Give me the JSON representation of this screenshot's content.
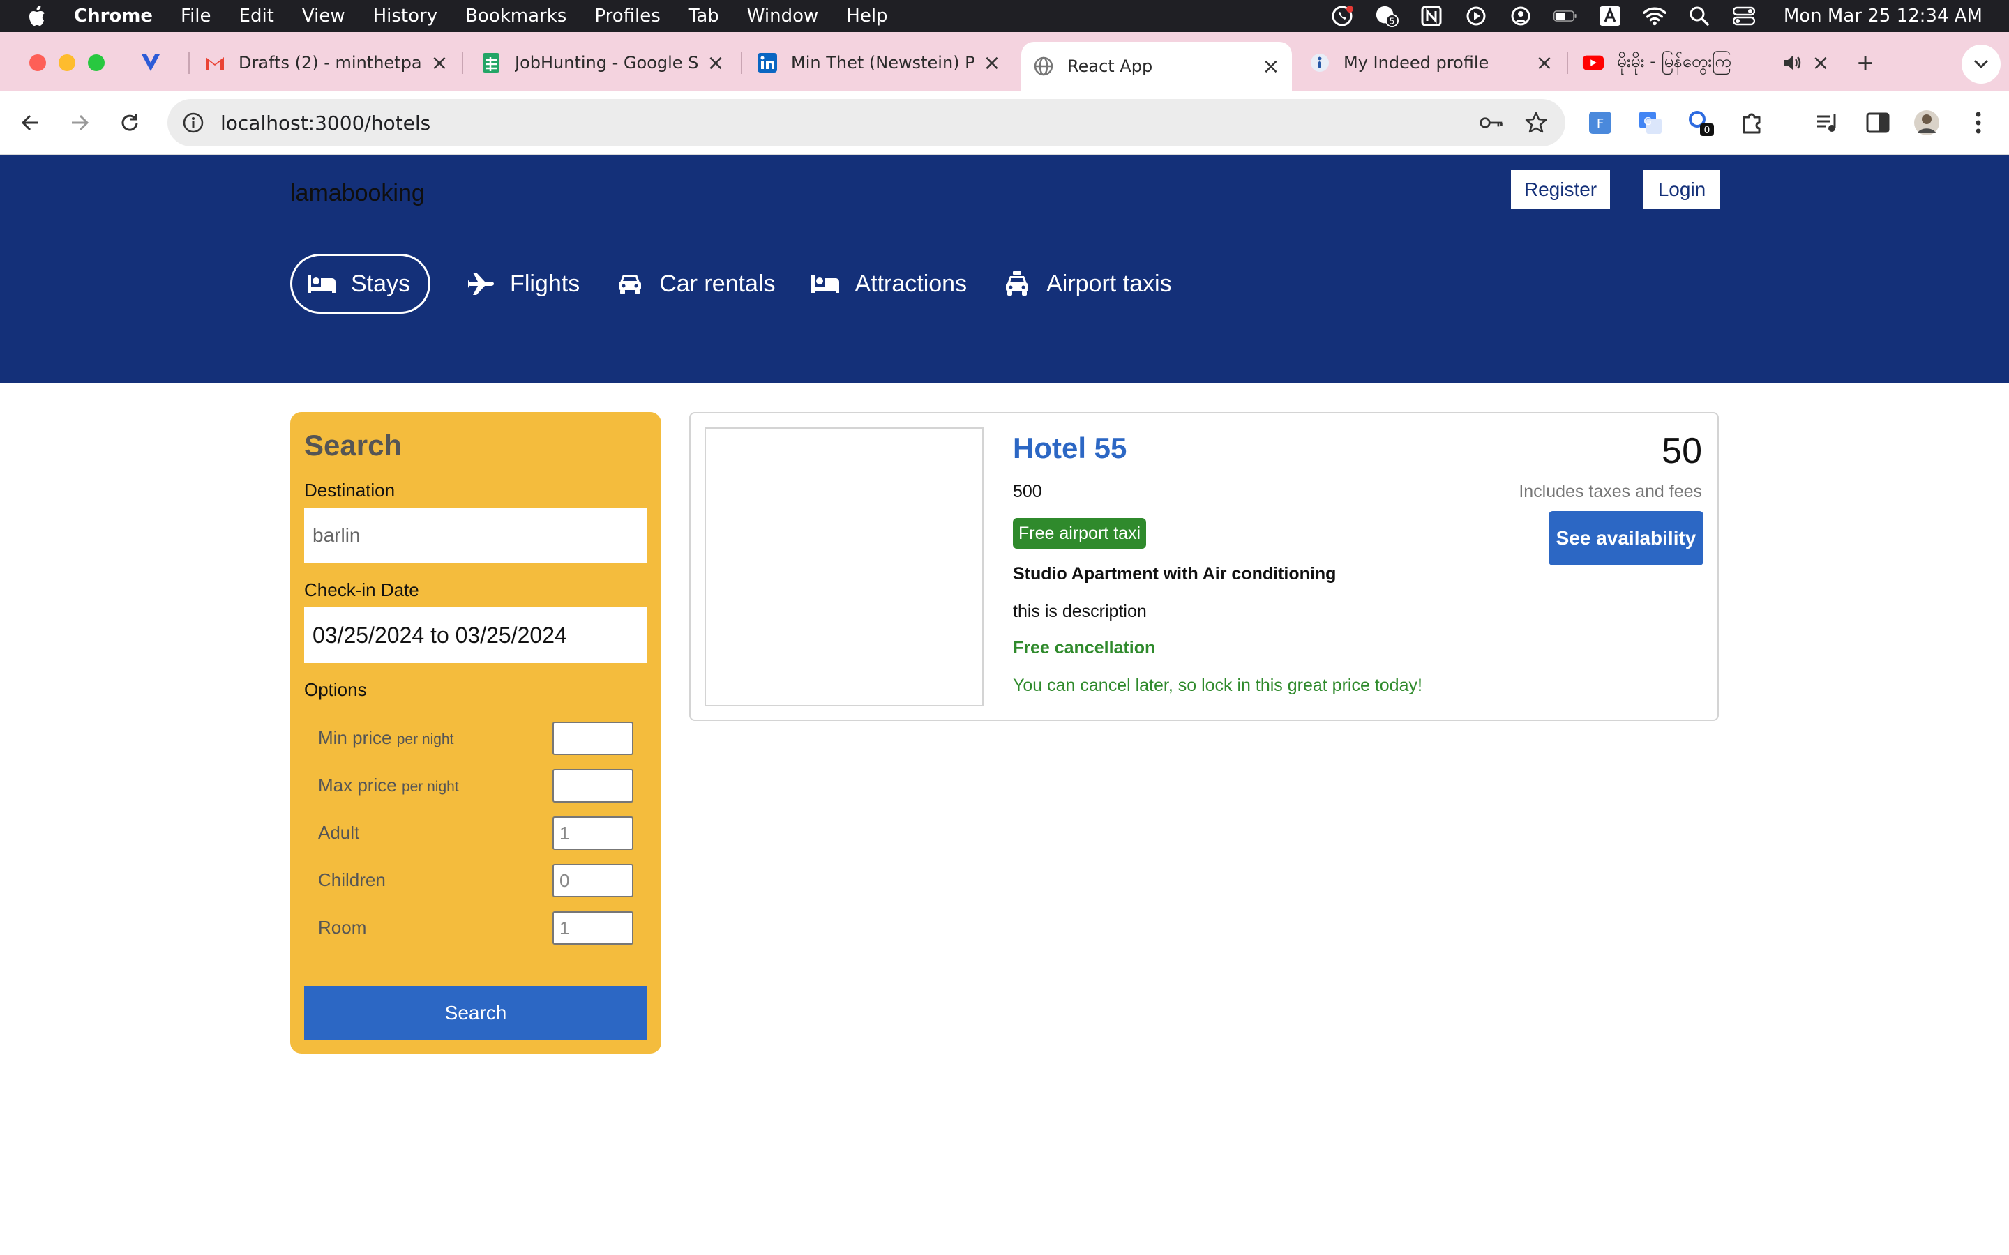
{
  "menubar": {
    "app_name": "Chrome",
    "items": [
      "File",
      "Edit",
      "View",
      "History",
      "Bookmarks",
      "Profiles",
      "Tab",
      "Window",
      "Help"
    ],
    "clock": "Mon Mar 25  12:34 AM",
    "notification_count": "5"
  },
  "tabs": [
    {
      "title": "",
      "icon": "vivaldi-like-icon"
    },
    {
      "title": "Drafts (2) - minthetpai",
      "icon": "gmail-icon"
    },
    {
      "title": "JobHunting - Google S",
      "icon": "google-sheets-icon"
    },
    {
      "title": "Min Thet (Newstein) P",
      "icon": "linkedin-icon"
    },
    {
      "title": "React App",
      "icon": "globe-icon"
    },
    {
      "title": "My Indeed profile",
      "icon": "indeed-icon"
    },
    {
      "title": "မိုးမိုး - မြန်တွေးကြ",
      "icon": "youtube-icon"
    }
  ],
  "toolbar": {
    "url": "localhost:3000/hotels",
    "extension_badge": "0"
  },
  "header": {
    "logo": "lamabooking",
    "register_label": "Register",
    "login_label": "Login",
    "nav": [
      {
        "label": "Stays",
        "icon": "bed-icon"
      },
      {
        "label": "Flights",
        "icon": "plane-icon"
      },
      {
        "label": "Car rentals",
        "icon": "car-icon"
      },
      {
        "label": "Attractions",
        "icon": "bed-icon"
      },
      {
        "label": "Airport taxis",
        "icon": "taxi-icon"
      }
    ]
  },
  "search": {
    "title": "Search",
    "destination_label": "Destination",
    "destination_value": "barlin",
    "checkin_label": "Check-in Date",
    "checkin_value": "03/25/2024 to 03/25/2024",
    "options_label": "Options",
    "options": [
      {
        "label": "Min price",
        "suffix": "per night",
        "value": ""
      },
      {
        "label": "Max price",
        "suffix": "per night",
        "value": ""
      },
      {
        "label": "Adult",
        "suffix": "",
        "value": "1"
      },
      {
        "label": "Children",
        "suffix": "",
        "value": "0"
      },
      {
        "label": "Room",
        "suffix": "",
        "value": "1"
      }
    ],
    "button_label": "Search"
  },
  "result": {
    "name": "Hotel 55",
    "distance": "500",
    "taxi_badge": "Free airport taxi",
    "subtitle": "Studio Apartment with Air conditioning",
    "description": "this is description",
    "cancel_title": "Free cancellation",
    "cancel_subtitle": "You can cancel later, so lock in this great price today!",
    "price": "50",
    "taxes": "Includes taxes and fees",
    "availability_label": "See availability"
  },
  "colors": {
    "header_bg": "#143079",
    "panel_bg": "#f4bc3d",
    "primary_blue": "#2c67c4",
    "green": "#2f8a2c",
    "tabstrip_bg": "#f4d3df"
  }
}
